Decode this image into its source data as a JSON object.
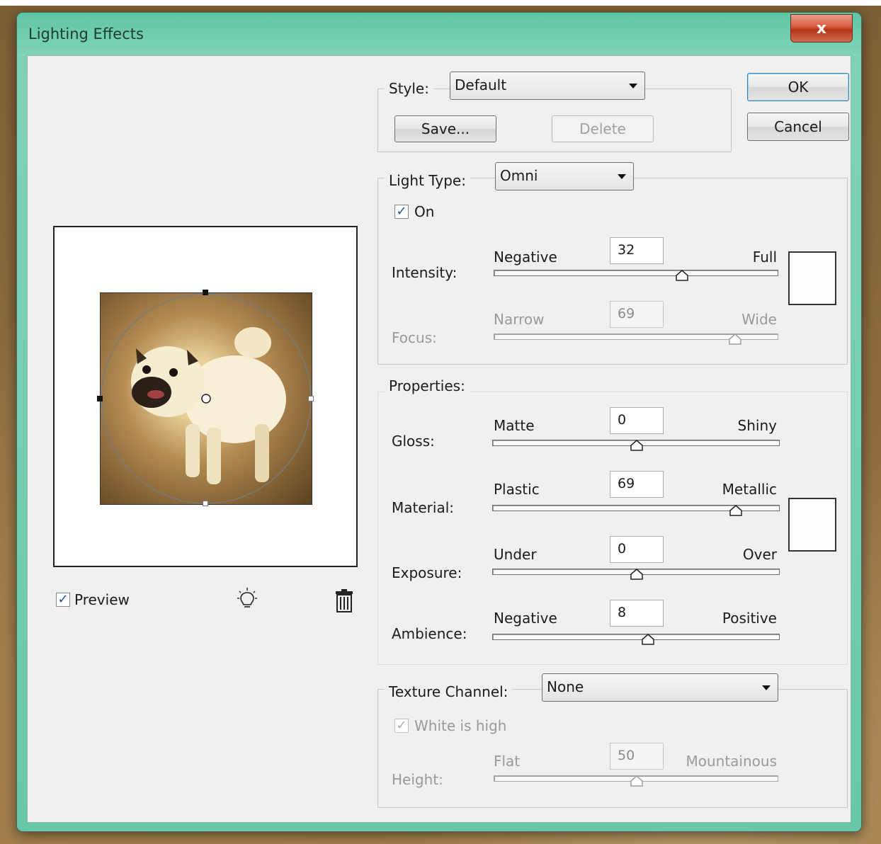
{
  "window": {
    "title": "Lighting Effects",
    "close_glyph": "x"
  },
  "style_group": {
    "label": "Style:",
    "selected": "Default",
    "save_label": "Save...",
    "delete_label": "Delete"
  },
  "buttons": {
    "ok": "OK",
    "cancel": "Cancel"
  },
  "light_type": {
    "label": "Light Type:",
    "selected": "Omni",
    "on_label": "On",
    "on_checked": true,
    "intensity": {
      "label": "Intensity:",
      "min_label": "Negative",
      "max_label": "Full",
      "value": "32",
      "range": [
        -100,
        100
      ],
      "color": "#fdfbfa"
    },
    "focus": {
      "label": "Focus:",
      "min_label": "Narrow",
      "max_label": "Wide",
      "value": "69",
      "range": [
        -100,
        100
      ],
      "enabled": false
    }
  },
  "properties": {
    "label": "Properties:",
    "gloss": {
      "label": "Gloss:",
      "min_label": "Matte",
      "max_label": "Shiny",
      "value": "0",
      "range": [
        -100,
        100
      ]
    },
    "material": {
      "label": "Material:",
      "min_label": "Plastic",
      "max_label": "Metallic",
      "value": "69",
      "range": [
        -100,
        100
      ],
      "color": "#ffffff"
    },
    "exposure": {
      "label": "Exposure:",
      "min_label": "Under",
      "max_label": "Over",
      "value": "0",
      "range": [
        -100,
        100
      ]
    },
    "ambience": {
      "label": "Ambience:",
      "min_label": "Negative",
      "max_label": "Positive",
      "value": "8",
      "range": [
        -100,
        100
      ]
    }
  },
  "texture": {
    "label": "Texture Channel:",
    "selected": "None",
    "white_is_high_label": "White is high",
    "white_is_high_checked": true,
    "height": {
      "label": "Height:",
      "min_label": "Flat",
      "max_label": "Mountainous",
      "value": "50",
      "range": [
        0,
        100
      ],
      "enabled": false
    }
  },
  "preview": {
    "checkbox_label": "Preview",
    "checked": true,
    "icons": [
      "light-bulb-icon",
      "trash-icon"
    ]
  },
  "colors": {
    "titlebar": "#6ac8a8",
    "dialog_bg": "#f0f0f0",
    "close_red": "#c84a2c"
  }
}
